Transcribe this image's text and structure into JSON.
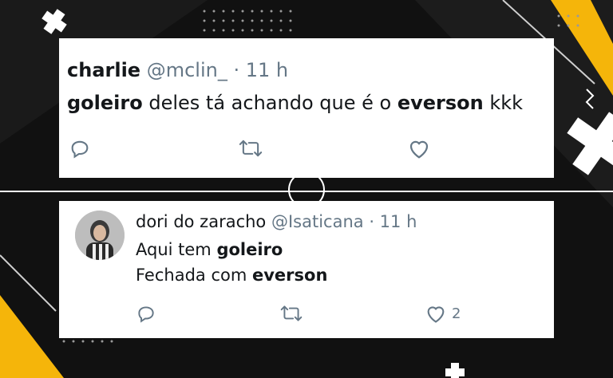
{
  "colors": {
    "background": "#111111",
    "accent_yellow": "#f5b50a",
    "card": "#ffffff",
    "muted": "#657786",
    "text": "#14171a"
  },
  "tweet1": {
    "name": "charlie",
    "handle": "@mclin_",
    "time": "· 11 h",
    "text": [
      {
        "bold": "goleiro",
        "rest": " deles tá achando que é o "
      },
      {
        "bold": "everson",
        "rest": " kkk"
      }
    ],
    "actions": {
      "reply": "reply-icon",
      "retweet": "retweet-icon",
      "like": "heart-icon"
    }
  },
  "tweet2": {
    "name": "dori do zaracho",
    "handle": "@Isaticana",
    "time": "· 11 h",
    "line1_prefix": "Aqui tem ",
    "line1_bold": "goleiro",
    "line2_prefix": "Fechada com ",
    "line2_bold": "everson",
    "likes": "2",
    "actions": {
      "reply": "reply-icon",
      "retweet": "retweet-icon",
      "like": "heart-icon"
    }
  }
}
